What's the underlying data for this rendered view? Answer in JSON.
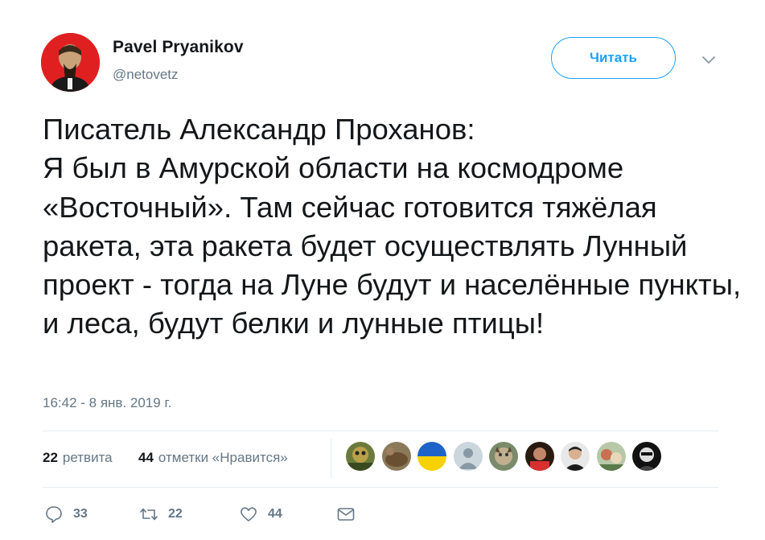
{
  "author": {
    "name": "Pavel Pryanikov",
    "handle": "@netovetz",
    "avatar_icon": "avatar-red-portrait"
  },
  "follow_button": {
    "label": "Читать"
  },
  "tweet": {
    "text": "Писатель Александр Проханов:\nЯ был в Амурской области на космодроме «Восточный». Там сейчас готовится тяжёлая ракета, эта ракета будет осуществлять Лунный проект - тогда на Луне будут и населённые пункты, и леса, будут белки и лунные птицы!",
    "timestamp": "16:42 - 8 янв. 2019 г."
  },
  "stats": {
    "retweets_count": "22",
    "retweets_label": "ретвита",
    "likes_count": "44",
    "likes_label": "отметки «Нравится»"
  },
  "likers": [
    {
      "icon": "liker-1"
    },
    {
      "icon": "liker-2"
    },
    {
      "icon": "liker-3-ukraine-flag"
    },
    {
      "icon": "liker-4-default"
    },
    {
      "icon": "liker-5"
    },
    {
      "icon": "liker-6"
    },
    {
      "icon": "liker-7"
    },
    {
      "icon": "liker-8"
    },
    {
      "icon": "liker-9"
    }
  ],
  "actions": {
    "reply_count": "33",
    "retweet_count": "22",
    "like_count": "44"
  },
  "colors": {
    "accent": "#1da1f2",
    "text": "#14171a",
    "muted": "#657786",
    "divider": "#e6ecf0"
  }
}
